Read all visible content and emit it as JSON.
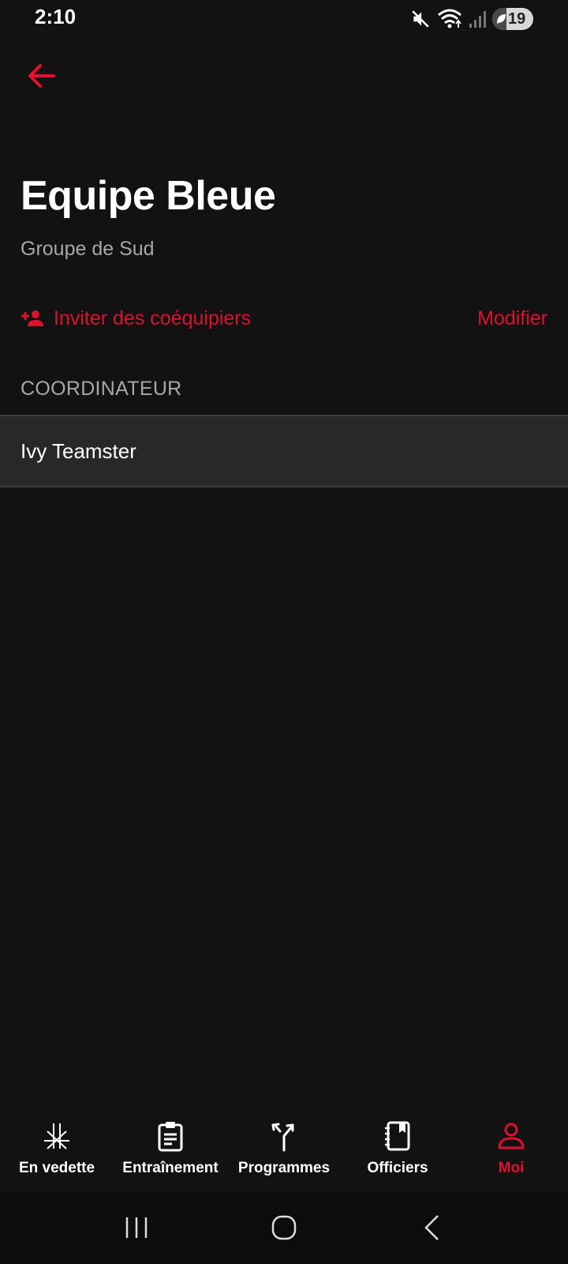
{
  "status_bar": {
    "time": "2:10",
    "battery_level": "19",
    "icons": [
      "mute-icon",
      "wifi-icon",
      "signal-icon",
      "battery-icon"
    ]
  },
  "header": {
    "title": "Equipe Bleue",
    "subtitle": "Groupe de Sud"
  },
  "actions": {
    "invite_label": "Inviter des coéquipiers",
    "edit_label": "Modifier"
  },
  "section": {
    "title": "COORDINATEUR",
    "members": [
      "Ivy Teamster"
    ]
  },
  "bottom_nav": {
    "items": [
      {
        "label": "En vedette",
        "icon": "featured-icon",
        "active": false
      },
      {
        "label": "Entraînement",
        "icon": "clipboard-icon",
        "active": false
      },
      {
        "label": "Programmes",
        "icon": "merge-arrows-icon",
        "active": false
      },
      {
        "label": "Officiers",
        "icon": "notebook-icon",
        "active": false
      },
      {
        "label": "Moi",
        "icon": "person-icon",
        "active": true
      }
    ]
  },
  "colors": {
    "accent": "#e0102f",
    "background": "#121212",
    "row_background": "#282828"
  }
}
